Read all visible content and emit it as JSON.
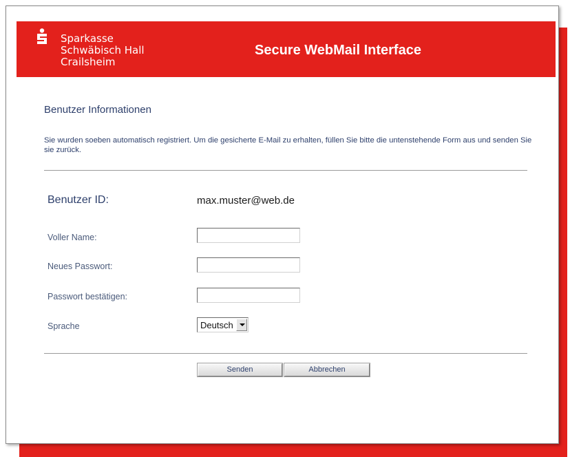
{
  "header": {
    "brand_lines": [
      "Sparkasse",
      "Schwäbisch Hall",
      "Crailsheim"
    ],
    "title": "Secure WebMail Interface",
    "color": "#e3211c"
  },
  "section_title": "Benutzer Informationen",
  "intro_text": "Sie wurden soeben automatisch registriert.  Um die gesicherte E-Mail zu erhalten, füllen Sie bitte die untenstehende Form aus und senden Sie sie zurück.",
  "user_id": {
    "label": "Benutzer ID:",
    "value": "max.muster@web.de"
  },
  "form": {
    "full_name_label": "Voller Name:",
    "full_name_value": "",
    "new_password_label": "Neues Passwort:",
    "new_password_value": "",
    "confirm_password_label": "Passwort bestätigen:",
    "confirm_password_value": "",
    "language_label": "Sprache",
    "language_value": "Deutsch"
  },
  "buttons": {
    "submit": "Senden",
    "cancel": "Abbrechen"
  }
}
